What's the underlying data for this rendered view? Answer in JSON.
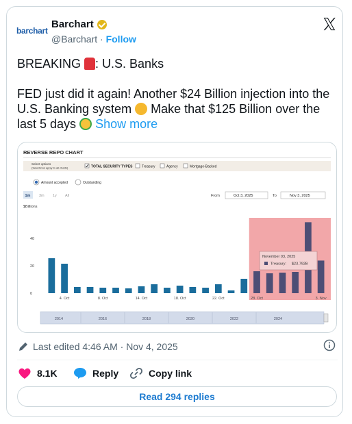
{
  "author": {
    "logo_text": "barchart",
    "name": "Barchart",
    "handle": "@Barchart",
    "separator": "·",
    "follow_label": "Follow"
  },
  "post": {
    "line1_prefix": "BREAKING ",
    "line1_suffix": ": U.S. Banks",
    "body": "FED just did it again!  Another $24 Billion injection into the U.S. Banking system ",
    "body2": " Make that $125 Billion over the last 5 days ",
    "show_more": "Show more"
  },
  "chart_panel": {
    "title": "REVERSE REPO CHART",
    "select_options_label": "Select options",
    "select_options_sub": "(Selections apply to all charts)",
    "checkboxes": [
      {
        "label": "TOTAL SECURITY TYPES",
        "checked": true
      },
      {
        "label": "Treasury",
        "checked": false
      },
      {
        "label": "Agency",
        "checked": false
      },
      {
        "label": "Mortgage-Backed",
        "checked": false
      }
    ],
    "radios": [
      {
        "label": "Amount accepted",
        "selected": true
      },
      {
        "label": "Outstanding",
        "selected": false
      }
    ],
    "ranges": [
      "1m",
      "3m",
      "1y",
      "All"
    ],
    "active_range": "1m",
    "from_label": "From",
    "from_value": "Oct 3, 2025",
    "to_label": "To",
    "to_value": "Nov 3, 2025",
    "unit_label": "$Billions",
    "tooltip_date": "November 03, 2025",
    "tooltip_series": "Treasury:",
    "tooltip_value": "$23.792B",
    "navigator_years": [
      "2014",
      "2016",
      "2018",
      "2020",
      "2022",
      "2024"
    ]
  },
  "chart_data": {
    "type": "bar",
    "ylabel": "$Billions",
    "yticks": [
      0,
      20,
      40
    ],
    "ylim": [
      0,
      57
    ],
    "xtick_labels": [
      "4. Oct",
      "8. Oct",
      "14. Oct",
      "18. Oct",
      "22. Oct",
      "28. Oct",
      "3. Nov"
    ],
    "values": [
      25.5,
      21.5,
      4.5,
      4.5,
      4,
      4,
      3.5,
      5,
      6.5,
      4,
      5.5,
      4.5,
      4,
      6.5,
      2,
      10.5,
      16,
      14.5,
      15,
      15.5,
      51.8,
      23.8
    ],
    "highlight_from_index": 16,
    "colors": {
      "bar": "#1a6d9c",
      "bar_highlight": "#4d4e75",
      "highlight_band": "#f2a7a9"
    }
  },
  "footer": {
    "edited_text": "Last edited 4:46 AM · Nov 4, 2025",
    "likes": "8.1K",
    "reply_label": "Reply",
    "copy_link_label": "Copy link",
    "read_replies_label": "Read 294 replies"
  },
  "colors": {
    "accent": "#1d9bf0",
    "like": "#f91880",
    "verified": "#e2b719"
  }
}
